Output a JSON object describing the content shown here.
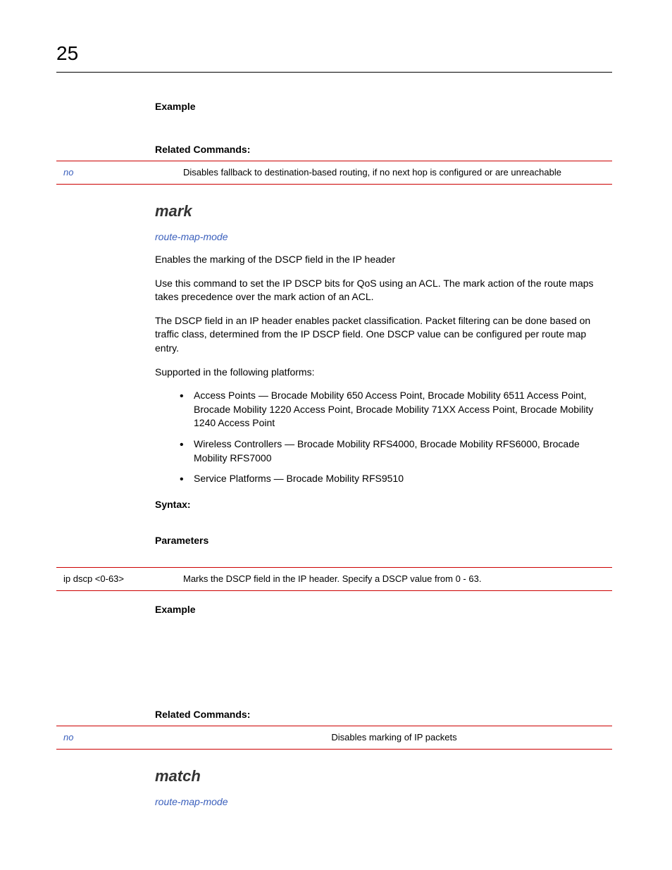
{
  "page_number": "25",
  "sec1": {
    "example_label": "Example",
    "related_label": "Related Commands:",
    "table": {
      "left": "no",
      "right": "Disables fallback to destination-based routing, if no next hop is configured or are unreachable"
    }
  },
  "mark": {
    "heading": "mark",
    "link": "route-map-mode",
    "p1": "Enables the marking of the DSCP field in the IP header",
    "p2": "Use this command to set the IP DSCP bits for QoS using an ACL. The mark action of the route maps takes precedence over the mark action of an ACL.",
    "p3": "The DSCP field in an IP header enables packet classification. Packet filtering can be done based on traffic class, determined from the IP DSCP field. One DSCP value can be configured per route map entry.",
    "p4": "Supported in the following platforms:",
    "bullets": [
      "Access Points — Brocade Mobility 650 Access Point, Brocade Mobility 6511 Access Point, Brocade Mobility 1220 Access Point, Brocade Mobility 71XX Access Point, Brocade Mobility 1240 Access Point",
      "Wireless Controllers — Brocade Mobility RFS4000, Brocade Mobility RFS6000, Brocade Mobility RFS7000",
      "Service Platforms — Brocade Mobility RFS9510"
    ],
    "syntax_label": "Syntax:",
    "params_label": "Parameters",
    "params_table": {
      "left": "ip dscp <0-63>",
      "right": "Marks the DSCP field in the IP header. Specify a DSCP value from 0 - 63."
    },
    "example_label": "Example",
    "related_label": "Related Commands:",
    "related_table": {
      "left": "no",
      "right": "Disables marking of IP packets"
    }
  },
  "match": {
    "heading": "match",
    "link": "route-map-mode"
  }
}
